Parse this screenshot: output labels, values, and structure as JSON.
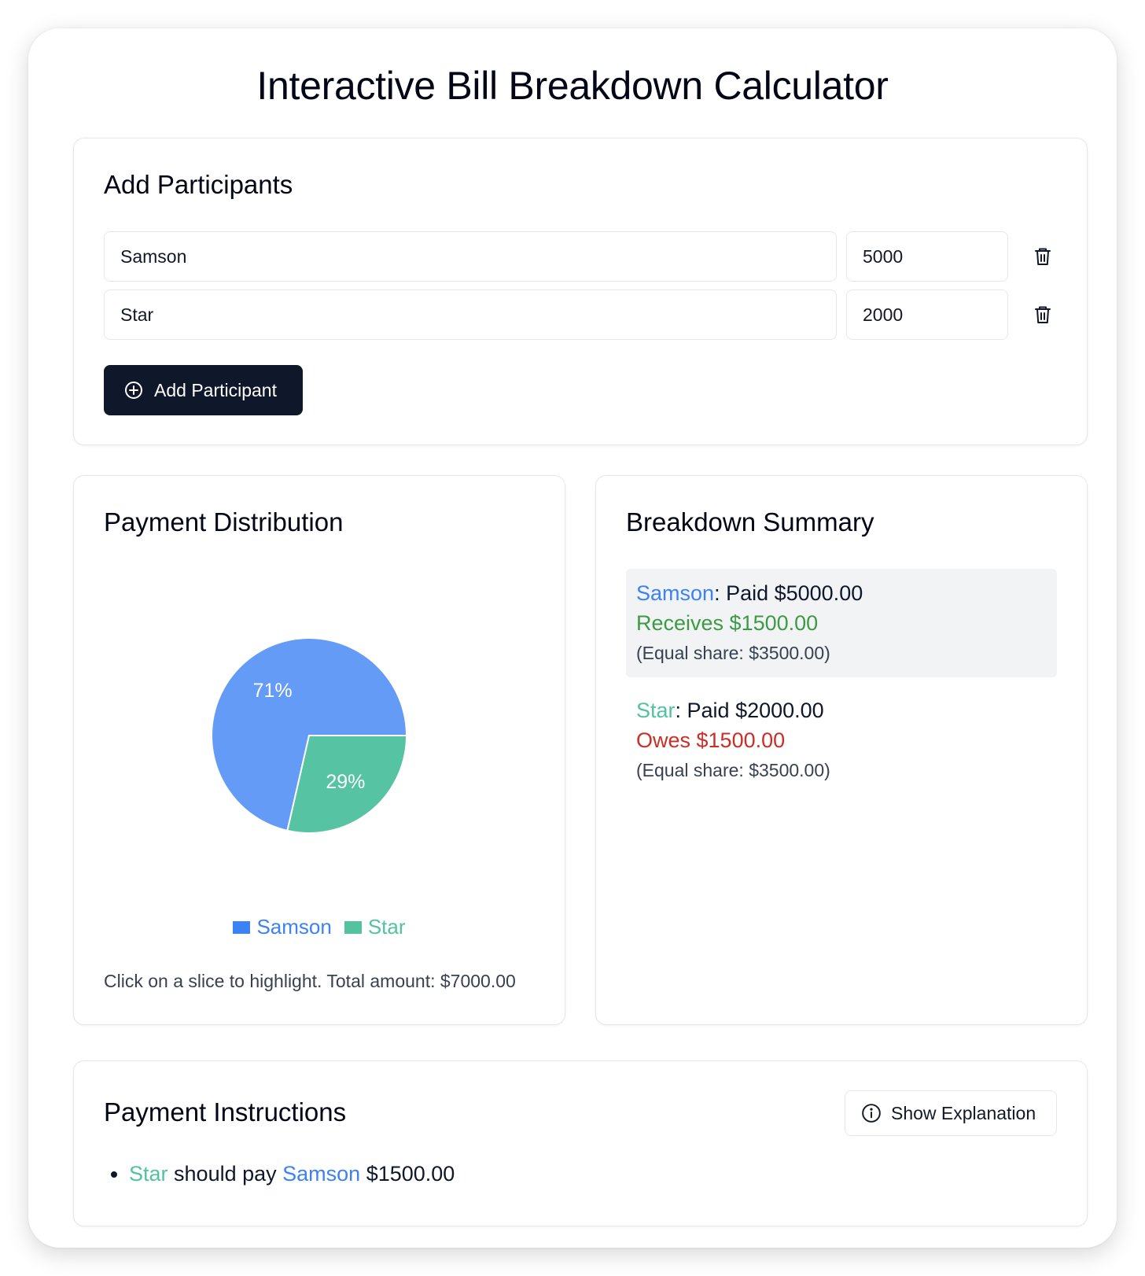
{
  "title": "Interactive Bill Breakdown Calculator",
  "colors": {
    "samson": "#3b82f6",
    "star": "#52c29f",
    "pie_samson": "#649bf6",
    "pie_star": "#56c3a2",
    "receives": "#3d9a45",
    "owes": "#cc2d24"
  },
  "participants": {
    "heading": "Add Participants",
    "rows": [
      {
        "name": "Samson",
        "amount": "5000",
        "delete_icon": "trash-icon"
      },
      {
        "name": "Star",
        "amount": "2000",
        "delete_icon": "trash-icon"
      }
    ],
    "add_button": {
      "label": "Add Participant",
      "icon": "plus-circle-icon"
    }
  },
  "distribution": {
    "heading": "Payment Distribution",
    "legend": [
      "Samson",
      "Star"
    ],
    "note": "Click on a slice to highlight. Total amount: $7000.00"
  },
  "chart_data": {
    "type": "pie",
    "categories": [
      "Samson",
      "Star"
    ],
    "values": [
      5000,
      2000
    ],
    "labels": [
      "71%",
      "29%"
    ],
    "legend_position": "bottom"
  },
  "summary": {
    "heading": "Breakdown Summary",
    "entries": [
      {
        "name": "Samson",
        "paid": ": Paid $5000.00",
        "status": "Receives $1500.00",
        "status_type": "receives",
        "share": "(Equal share: $3500.00)"
      },
      {
        "name": "Star",
        "paid": ": Paid $2000.00",
        "status": "Owes $1500.00",
        "status_type": "owes",
        "share": "(Equal share: $3500.00)"
      }
    ]
  },
  "instructions": {
    "heading": "Payment Instructions",
    "explain_button": {
      "label": "Show Explanation",
      "icon": "info-circle-icon"
    },
    "items": [
      {
        "from": "Star",
        "verb": " should pay ",
        "to": "Samson",
        "amount": " $1500.00"
      }
    ]
  }
}
